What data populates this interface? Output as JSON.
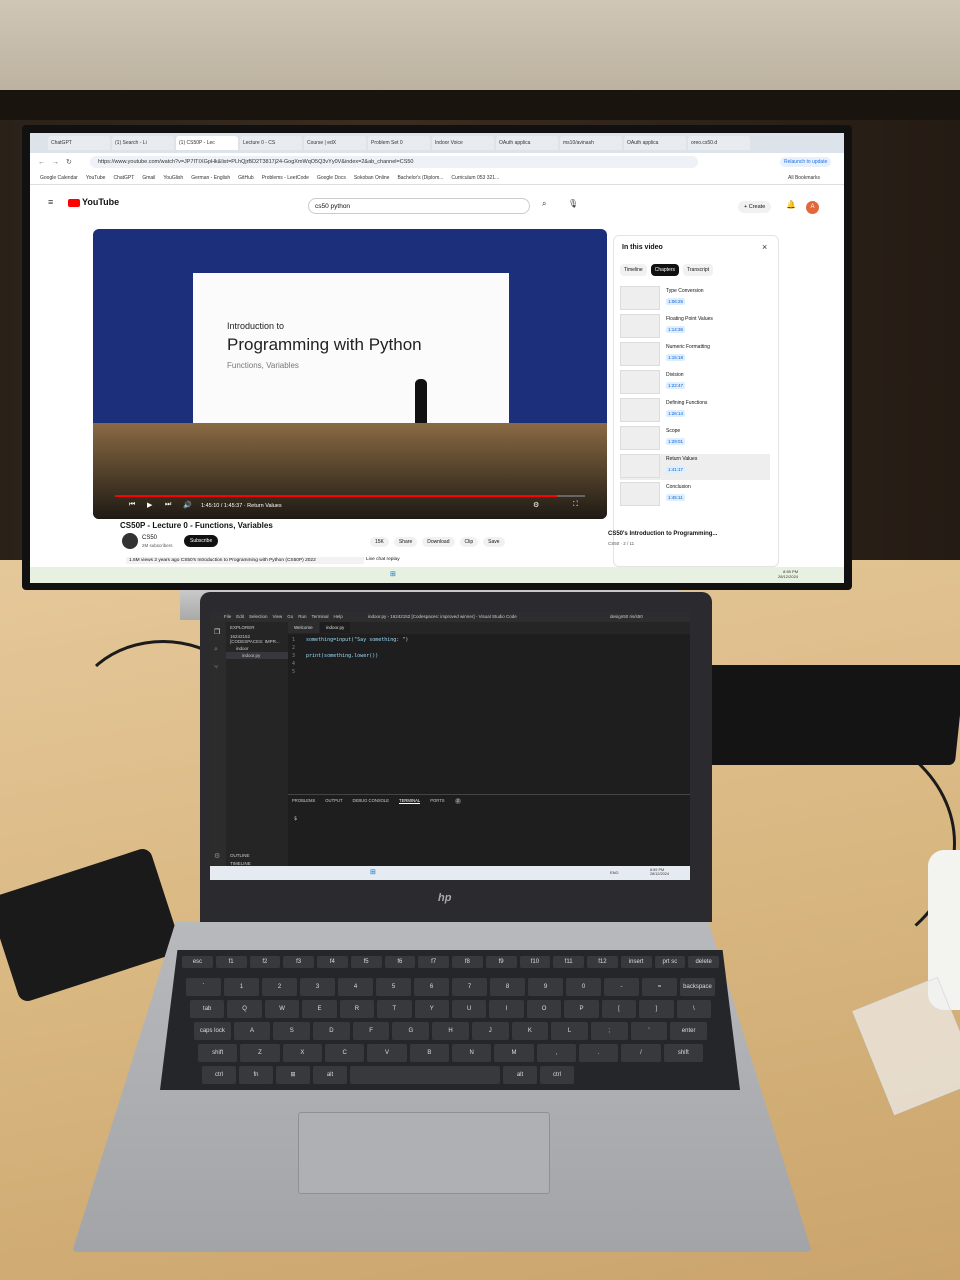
{
  "browser": {
    "tabs": [
      "ChatGPT",
      "(1) Search - Li",
      "(1) CS50P - Lec",
      "Lecture 0 - CS",
      "Course | edX",
      "Problem Set 0",
      "Indoor Voice",
      "OAuth applica",
      "ms10/avinash",
      "OAuth applica",
      "oreo.cs50.d"
    ],
    "url": "https://www.youtube.com/watch?v=JP7ITIXGpHk&list=PLhQjrBD2T3817j24-GogXmWqO5Q3vYy0V&index=2&ab_channel=CS50",
    "bookmarks": [
      "Google Calendar",
      "YouTube",
      "ChatGPT",
      "Gmail",
      "YouGlish",
      "German - English",
      "GitHub",
      "Problems - LeetCode",
      "Google Docs",
      "Sokoban Online",
      "Bachelor's (Diplom...",
      "Curriculum 053 321..."
    ],
    "update_label": "Relaunch to update",
    "all_bookmarks": "All Bookmarks"
  },
  "youtube": {
    "logo": "YouTube",
    "search_query": "cs50 python",
    "create_label": "Create",
    "avatar_letter": "A",
    "video": {
      "slide_line1": "Introduction to",
      "slide_title": "Programming with Python",
      "slide_line3": "Functions, Variables",
      "time": "1:45:10 / 1:45:37 · Return Values",
      "progress": 0.94
    },
    "title": "CS50P - Lecture 0 - Functions, Variables",
    "channel": "CS50",
    "subscribers": "2M subscribers",
    "subscribe_label": "Subscribe",
    "actions": [
      "15K",
      "Share",
      "Download",
      "Clip",
      "Save"
    ],
    "views": "1.6M views  2 years ago  CS50's Introduction to Programming with Python (CS50P) 2022",
    "live_chat": "Live chat replay",
    "panel": {
      "title": "In this video",
      "tabs": [
        "Timeline",
        "Chapters",
        "Transcript"
      ],
      "chapters": [
        {
          "name": "Type Conversion",
          "time": "1:06:25"
        },
        {
          "name": "Floating Point Values",
          "time": "1:14:36"
        },
        {
          "name": "Numeric Formatting",
          "time": "1:15:18"
        },
        {
          "name": "Division",
          "time": "1:22:47"
        },
        {
          "name": "Defining Functions",
          "time": "1:26:14"
        },
        {
          "name": "Scope",
          "time": "1:29:01"
        },
        {
          "name": "Return Values",
          "time": "1:41:17"
        },
        {
          "name": "Conclusion",
          "time": "1:45:11"
        }
      ]
    },
    "next_playlist": "CS50's Introduction to Programming...",
    "next_sub": "CS50 · 2 / 11"
  },
  "monitor_clock": {
    "time": "8:59 PM",
    "date": "28/12/2024"
  },
  "vscode": {
    "title_bar": "indoor.py - 16242152 [Codespaces: improved winner] - Visual Studio Code",
    "menu": [
      "File",
      "Edit",
      "Selection",
      "View",
      "Go",
      "Run",
      "Terminal",
      "Help"
    ],
    "explorer_label": "EXPLORER",
    "workspace": "16242152 [CODESPACES: IMPR...",
    "folder": "indoor",
    "file": "indoor.py",
    "tabs": [
      "Welcome",
      "indoor.py"
    ],
    "code_lines": [
      "something=input(\"Say something: \")",
      "",
      "print(something.lower())",
      ""
    ],
    "line_numbers": [
      "1",
      "2",
      "3",
      "4",
      "5"
    ],
    "panel_tabs": [
      "PROBLEMS",
      "OUTPUT",
      "DEBUG CONSOLE",
      "TERMINAL",
      "PORTS"
    ],
    "ports_count": "2",
    "prompt": "$",
    "outline": "OUTLINE",
    "timeline": "TIMELINE",
    "user": "design50  ris/s50"
  },
  "laptop_clock": {
    "time": "8:59 PM",
    "date": "28/12/2024",
    "lang": "ENG"
  },
  "laptop_brand": "hp",
  "keys": {
    "row_top": [
      "esc",
      "f1",
      "f2",
      "f3",
      "f4",
      "f5",
      "f6",
      "f7",
      "f8",
      "f9",
      "f10",
      "f11",
      "f12",
      "insert",
      "prt sc",
      "delete"
    ],
    "row1": [
      "`",
      "1",
      "2",
      "3",
      "4",
      "5",
      "6",
      "7",
      "8",
      "9",
      "0",
      "-",
      "=",
      "backspace"
    ],
    "row2": [
      "tab",
      "Q",
      "W",
      "E",
      "R",
      "T",
      "Y",
      "U",
      "I",
      "O",
      "P",
      "[",
      "]",
      "\\"
    ],
    "row3": [
      "caps lock",
      "A",
      "S",
      "D",
      "F",
      "G",
      "H",
      "J",
      "K",
      "L",
      ";",
      "'",
      "enter"
    ],
    "row4": [
      "shift",
      "Z",
      "X",
      "C",
      "V",
      "B",
      "N",
      "M",
      ",",
      ".",
      "/",
      "shift"
    ],
    "row5": [
      "ctrl",
      "fn",
      "⊞",
      "alt",
      "",
      "alt",
      "ctrl"
    ]
  },
  "colors": {
    "yt_red": "#ff0000",
    "vscode_bg": "#1e1e1e",
    "stage_blue": "#1b2f7a"
  }
}
